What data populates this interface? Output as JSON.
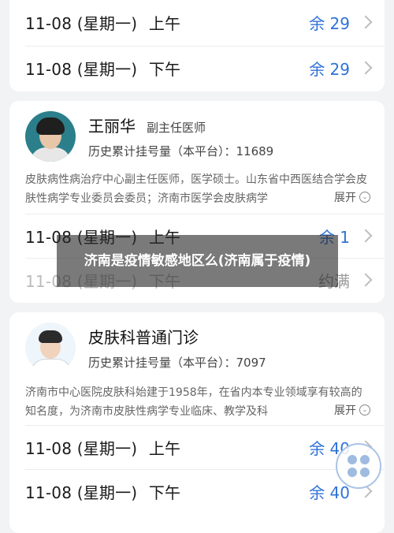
{
  "card1": {
    "slots": [
      {
        "date": "11-08",
        "weekday": "(星期一)",
        "period": "上午",
        "status": "余 29"
      },
      {
        "date": "11-08",
        "weekday": "(星期一)",
        "period": "下午",
        "status": "余 29"
      }
    ]
  },
  "card2": {
    "doctor_name": "王丽华",
    "doctor_title": "副主任医师",
    "history_count": "历史累计挂号量（本平台）：11689",
    "description": "皮肤病性病治疗中心副主任医师，医学硕士。山东省中西医结合学会皮肤性病学专业委员会委员；济南市医学会皮肤病学",
    "expand_label": "展开",
    "slots": [
      {
        "date": "11-08",
        "weekday": "(星期一)",
        "period": "上午",
        "status": "余 1"
      },
      {
        "date": "11-08",
        "weekday": "(星期一)",
        "period": "下午",
        "status": "约满"
      }
    ]
  },
  "overlay_text": "济南是疫情敏感地区么(济南属于疫情)",
  "card3": {
    "clinic_name": "皮肤科普通门诊",
    "history_count": "历史累计挂号量（本平台）：7097",
    "description": "济南市中心医院皮肤科始建于1958年，在省内本专业领域享有较高的知名度，为济南市皮肤性病学专业临床、教学及科",
    "expand_label": "展开",
    "slots": [
      {
        "date": "11-08",
        "weekday": "(星期一)",
        "period": "上午",
        "status": "余 40"
      },
      {
        "date": "11-08",
        "weekday": "(星期一)",
        "period": "下午",
        "status": "余 40"
      }
    ]
  },
  "colors": {
    "available": "#2f72d8",
    "full": "#9a9a9a"
  },
  "icons": {
    "chevron": "chevron-right-icon",
    "expand": "chevron-down-circle-icon",
    "fab": "four-dots-menu-icon"
  }
}
